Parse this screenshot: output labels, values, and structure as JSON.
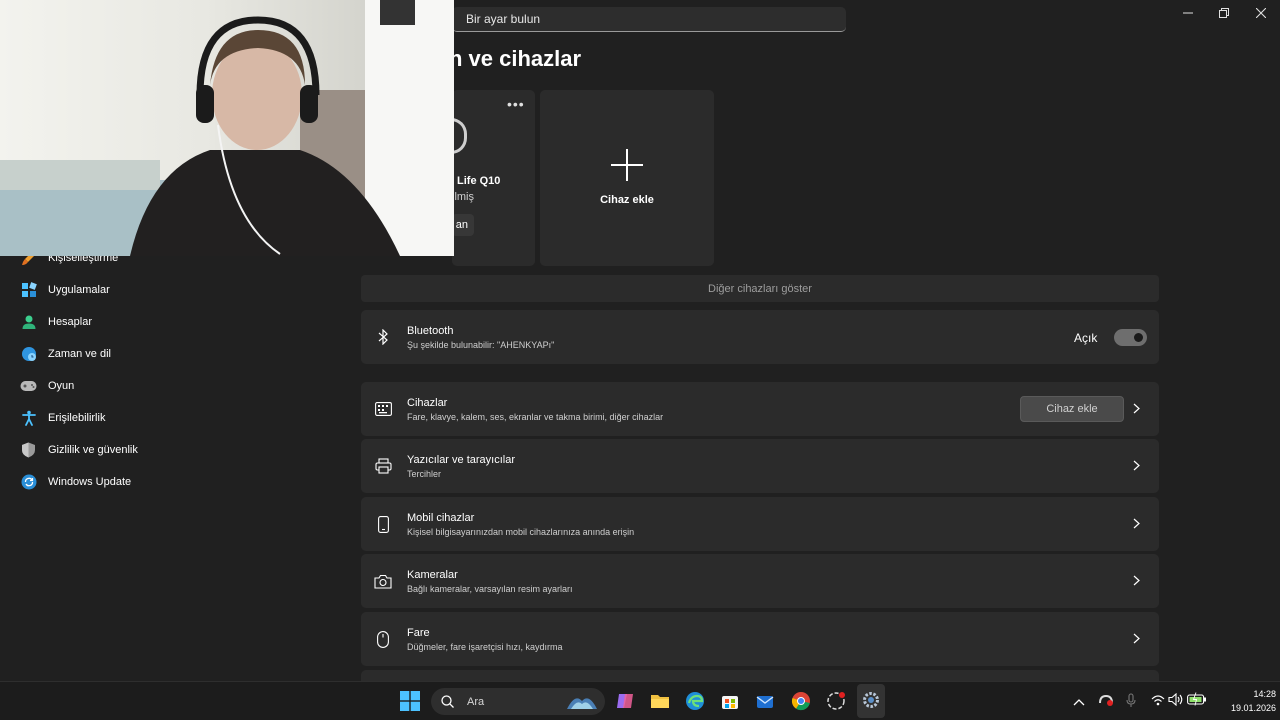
{
  "window": {
    "minimize_icon": "minimize-icon",
    "maximize_icon": "restore-icon",
    "close_icon": "close-icon"
  },
  "search": {
    "placeholder": "Bir ayar bulun"
  },
  "page": {
    "title": "n ve cihazlar"
  },
  "devices": {
    "card": {
      "name": "Life Q10",
      "status": "ilmiş",
      "button": "an"
    },
    "add": {
      "label": "Cihaz ekle"
    },
    "show_other": "Diğer cihazları göster"
  },
  "bluetooth": {
    "title": "Bluetooth",
    "subtitle": "Şu şekilde bulunabilir: \"AHENKYAPı\"",
    "toggle_label": "Açık",
    "state": "on"
  },
  "rows": [
    {
      "title": "Cihazlar",
      "subtitle": "Fare, klavye, kalem, ses, ekranlar ve takma birimi, diğer cihazlar",
      "button": "Cihaz ekle",
      "icon": "keyboard-icon"
    },
    {
      "title": "Yazıcılar ve tarayıcılar",
      "subtitle": "Tercihler",
      "icon": "printer-icon"
    },
    {
      "title": "Mobil cihazlar",
      "subtitle": "Kişisel bilgisayarınızdan mobil cihazlarınıza anında erişin",
      "icon": "phone-icon"
    },
    {
      "title": "Kameralar",
      "subtitle": "Bağlı kameralar, varsayılan resim ayarları",
      "icon": "camera-icon"
    },
    {
      "title": "Fare",
      "subtitle": "Düğmeler, fare işaretçisi hızı, kaydırma",
      "icon": "mouse-icon"
    }
  ],
  "sidebar": {
    "items": [
      {
        "label": "Kişiselleştirme",
        "icon": "brush-icon"
      },
      {
        "label": "Uygulamalar",
        "icon": "apps-icon"
      },
      {
        "label": "Hesaplar",
        "icon": "person-icon"
      },
      {
        "label": "Zaman ve dil",
        "icon": "globe-clock-icon"
      },
      {
        "label": "Oyun",
        "icon": "gamepad-icon"
      },
      {
        "label": "Erişilebilirlik",
        "icon": "accessibility-icon"
      },
      {
        "label": "Gizlilik ve güvenlik",
        "icon": "shield-icon"
      },
      {
        "label": "Windows Update",
        "icon": "update-icon"
      }
    ]
  },
  "taskbar": {
    "search_label": "Ara",
    "time": "14:28",
    "date": "19.01.2026"
  },
  "colors": {
    "background": "#202020",
    "card": "#2b2b2b",
    "taskbar": "#1c1c1c",
    "accent": "#4cc2ff"
  }
}
